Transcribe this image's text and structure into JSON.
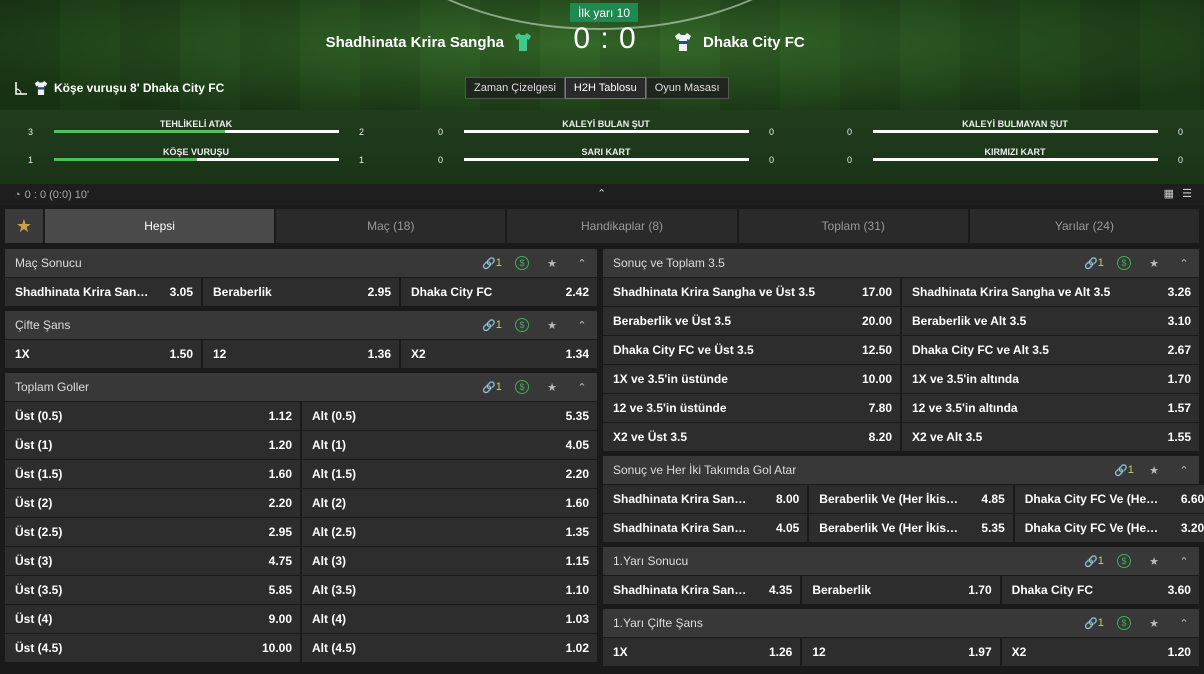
{
  "match": {
    "period": "İlk yarı 10",
    "home": "Shadhinata Krira Sangha",
    "away": "Dhaka City FC",
    "score": "0 : 0",
    "event": "Köşe vuruşu 8' Dhaka City FC"
  },
  "view_tabs": [
    "Zaman Çizelgesi",
    "H2H Tablosu",
    "Oyun Masası"
  ],
  "stats": [
    {
      "label": "TEHLİKELİ ATAK",
      "left": "3",
      "right": "2",
      "fill": 0.6
    },
    {
      "label": "KALEYİ BULAN ŞUT",
      "left": "0",
      "right": "0",
      "fill": 0
    },
    {
      "label": "KALEYİ BULMAYAN ŞUT",
      "left": "0",
      "right": "0",
      "fill": 0
    },
    {
      "label": "KÖŞE VURUŞU",
      "left": "1",
      "right": "1",
      "fill": 0.5
    },
    {
      "label": "SARI KART",
      "left": "0",
      "right": "0",
      "fill": 0
    },
    {
      "label": "KIRMIZI KART",
      "left": "0",
      "right": "0",
      "fill": 0
    }
  ],
  "subbar": "0 : 0 (0:0) 10'",
  "filters": [
    "Hepsi",
    "Maç (18)",
    "Handikaplar (8)",
    "Toplam (31)",
    "Yarılar (24)"
  ],
  "left_markets": [
    {
      "title": "Maç Sonucu",
      "link": "1",
      "rows": [
        [
          [
            "Shadhinata Krira Sangha",
            "3.05"
          ],
          [
            "Beraberlik",
            "2.95"
          ],
          [
            "Dhaka City FC",
            "2.42"
          ]
        ]
      ]
    },
    {
      "title": "Çifte Şans",
      "link": "1",
      "rows": [
        [
          [
            "1X",
            "1.50"
          ],
          [
            "12",
            "1.36"
          ],
          [
            "X2",
            "1.34"
          ]
        ]
      ]
    },
    {
      "title": "Toplam Goller",
      "link": "1",
      "rows": [
        [
          [
            "Üst (0.5)",
            "1.12"
          ],
          [
            "Alt (0.5)",
            "5.35"
          ]
        ],
        [
          [
            "Üst (1)",
            "1.20"
          ],
          [
            "Alt (1)",
            "4.05"
          ]
        ],
        [
          [
            "Üst (1.5)",
            "1.60"
          ],
          [
            "Alt (1.5)",
            "2.20"
          ]
        ],
        [
          [
            "Üst (2)",
            "2.20"
          ],
          [
            "Alt (2)",
            "1.60"
          ]
        ],
        [
          [
            "Üst (2.5)",
            "2.95"
          ],
          [
            "Alt (2.5)",
            "1.35"
          ]
        ],
        [
          [
            "Üst (3)",
            "4.75"
          ],
          [
            "Alt (3)",
            "1.15"
          ]
        ],
        [
          [
            "Üst (3.5)",
            "5.85"
          ],
          [
            "Alt (3.5)",
            "1.10"
          ]
        ],
        [
          [
            "Üst (4)",
            "9.00"
          ],
          [
            "Alt (4)",
            "1.03"
          ]
        ],
        [
          [
            "Üst (4.5)",
            "10.00"
          ],
          [
            "Alt (4.5)",
            "1.02"
          ]
        ]
      ]
    }
  ],
  "right_markets": [
    {
      "title": "Sonuç ve Toplam 3.5",
      "link": "1",
      "rows": [
        [
          [
            "Shadhinata Krira Sangha ve Üst 3.5",
            "17.00"
          ],
          [
            "Shadhinata Krira Sangha ve Alt 3.5",
            "3.26"
          ]
        ],
        [
          [
            "Beraberlik ve Üst 3.5",
            "20.00"
          ],
          [
            "Beraberlik ve Alt 3.5",
            "3.10"
          ]
        ],
        [
          [
            "Dhaka City FC ve Üst 3.5",
            "12.50"
          ],
          [
            "Dhaka City FC ve Alt 3.5",
            "2.67"
          ]
        ],
        [
          [
            "1X ve 3.5'in üstünde",
            "10.00"
          ],
          [
            "1X ve 3.5'in altında",
            "1.70"
          ]
        ],
        [
          [
            "12 ve 3.5'in üstünde",
            "7.80"
          ],
          [
            "12 ve 3.5'in altında",
            "1.57"
          ]
        ],
        [
          [
            "X2 ve Üst 3.5",
            "8.20"
          ],
          [
            "X2 ve Alt 3.5",
            "1.55"
          ]
        ]
      ]
    },
    {
      "title": "Sonuç ve Her İki Takımda Gol Atar",
      "link": "1",
      "rows": [
        [
          [
            "Shadhinata Krira Sangha V...",
            "8.00"
          ],
          [
            "Beraberlik Ve (Her İkisi De ...",
            "4.85"
          ],
          [
            "Dhaka City FC Ve (Her iki ...",
            "6.60"
          ]
        ],
        [
          [
            "Shadhinata Krira Sangha V...",
            "4.05"
          ],
          [
            "Beraberlik Ve (Her İkisi De ...",
            "5.35"
          ],
          [
            "Dhaka City FC Ve (Her iki ...",
            "3.20"
          ]
        ]
      ]
    },
    {
      "title": "1.Yarı Sonucu",
      "link": "1",
      "rows": [
        [
          [
            "Shadhinata Krira Sangha",
            "4.35"
          ],
          [
            "Beraberlik",
            "1.70"
          ],
          [
            "Dhaka City FC",
            "3.60"
          ]
        ]
      ]
    },
    {
      "title": "1.Yarı Çifte Şans",
      "link": "1",
      "rows": [
        [
          [
            "1X",
            "1.26"
          ],
          [
            "12",
            "1.97"
          ],
          [
            "X2",
            "1.20"
          ]
        ]
      ]
    }
  ]
}
